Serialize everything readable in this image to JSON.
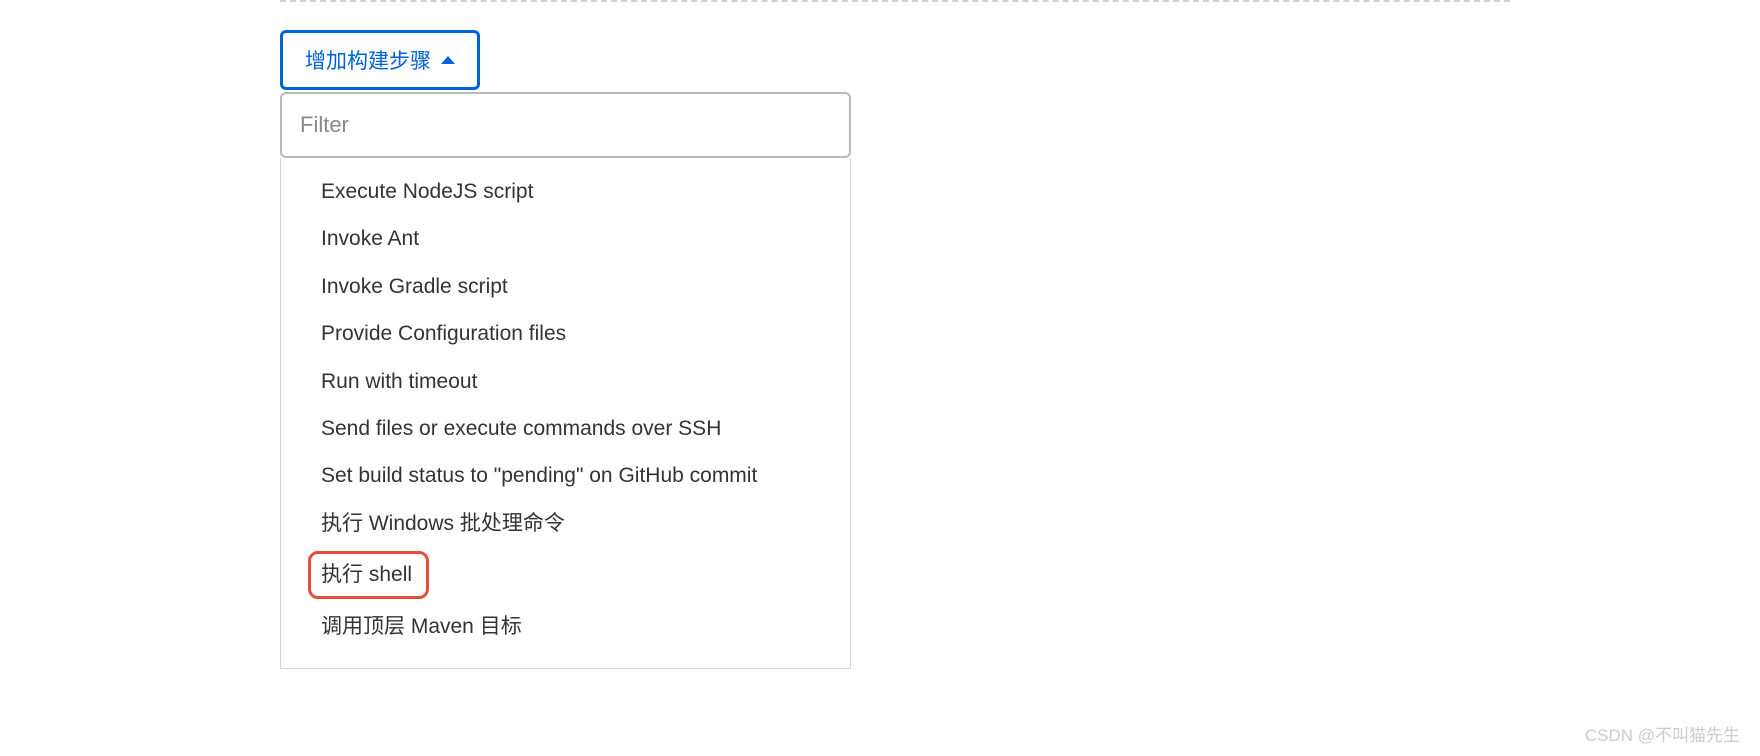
{
  "addStepButton": {
    "label": "增加构建步骤"
  },
  "filter": {
    "placeholder": "Filter",
    "value": ""
  },
  "dropdown": {
    "items": [
      "Execute NodeJS script",
      "Invoke Ant",
      "Invoke Gradle script",
      "Provide Configuration files",
      "Run with timeout",
      "Send files or execute commands over SSH",
      "Set build status to \"pending\" on GitHub commit",
      "执行 Windows 批处理命令",
      "执行 shell",
      "调用顶层 Maven 目标"
    ],
    "highlightedIndex": 8
  },
  "watermark": "CSDN @不叫猫先生"
}
